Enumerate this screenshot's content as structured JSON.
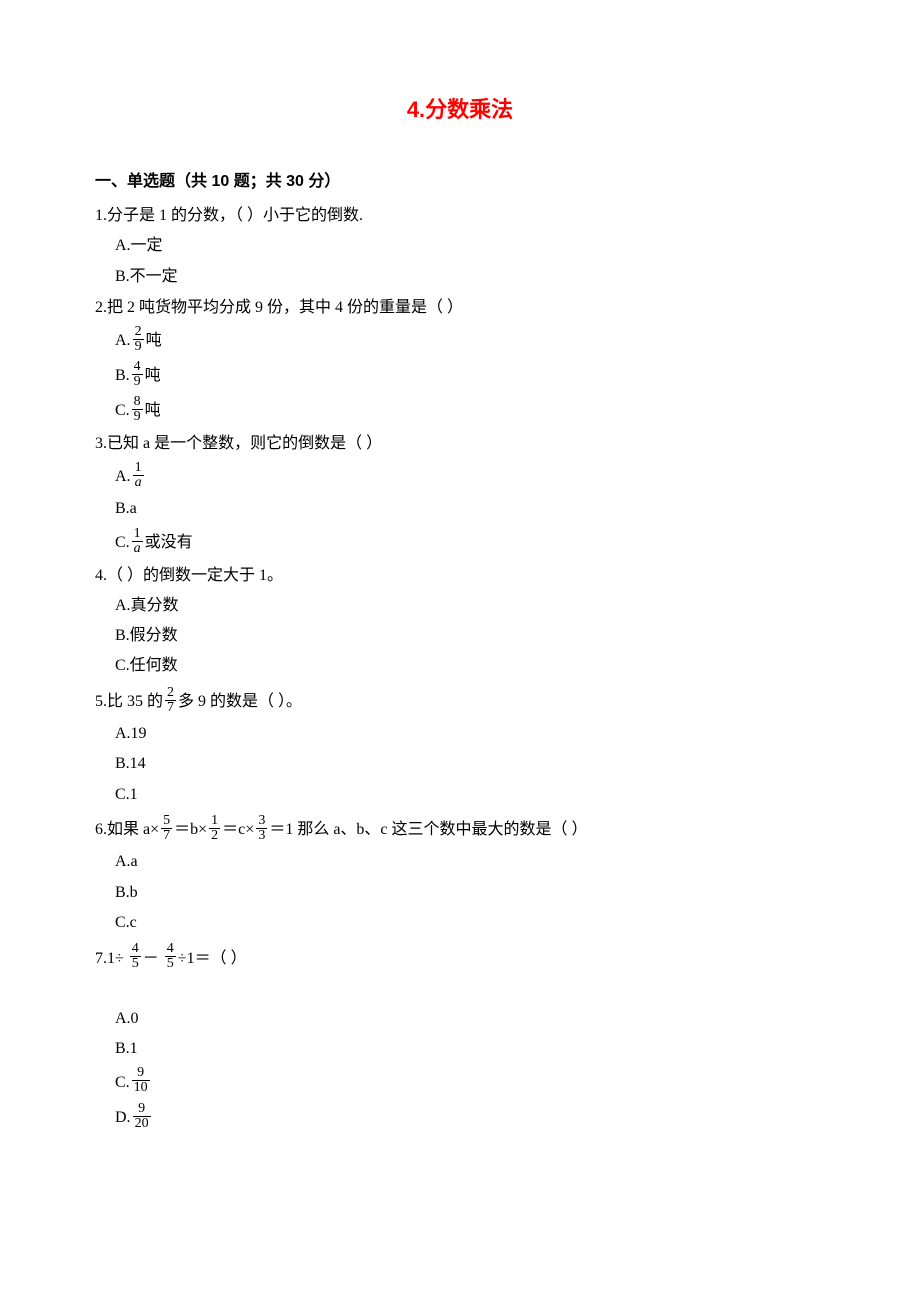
{
  "title": "4.分数乘法",
  "section_header": "一、单选题（共 10 题；共 30 分）",
  "q1": {
    "text": "1.分子是 1 的分数，（   ）小于它的倒数.",
    "A": "A.一定",
    "B": "B.不一定"
  },
  "q2": {
    "text_pre": "2.把 2 吨货物平均分成 9 份，其中 4 份的重量是（   ）",
    "A_pre": "A.",
    "A_num": "2",
    "A_den": "9",
    "A_post": "吨",
    "B_pre": "B.",
    "B_num": "4",
    "B_den": "9",
    "B_post": "吨",
    "C_pre": "C.",
    "C_num": "8",
    "C_den": "9",
    "C_post": "吨"
  },
  "q3": {
    "text": "3.已知 a 是一个整数，则它的倒数是（    ）",
    "A_pre": "A.",
    "A_num": "1",
    "A_den": "a",
    "B": "B.a",
    "C_pre": "C.",
    "C_num": "1",
    "C_den": "a",
    "C_post": "或没有"
  },
  "q4": {
    "text": "4.（            ）的倒数一定大于 1。",
    "A": "A.真分数",
    "B": "B.假分数",
    "C": "C.任何数"
  },
  "q5": {
    "text_pre": "5.比 35 的",
    "num": "2",
    "den": "7",
    "text_post": "多 9 的数是（            ）。",
    "A": "A.19",
    "B": "B.14",
    "C": "C.1"
  },
  "q6": {
    "text_pre": "6.如果 a×",
    "f1_num": "5",
    "f1_den": "7",
    "mid1": "＝b×",
    "f2_num": "1",
    "f2_den": "2",
    "mid2": "＝c×",
    "f3_num": "3",
    "f3_den": "3",
    "text_post": "＝1 那么 a、b、c 这三个数中最大的数是（    ）",
    "A": "A.a",
    "B": "B.b",
    "C": "C.c"
  },
  "q7": {
    "text_pre": "7.1÷ ",
    "f1_num": "4",
    "f1_den": "5",
    "mid": "－ ",
    "f2_num": "4",
    "f2_den": "5",
    "text_post": "÷1＝（   ）",
    "A": "A.0",
    "B": "B.1",
    "C_pre": "C.",
    "C_num": "9",
    "C_den": "10",
    "D_pre": "D.",
    "D_num": "9",
    "D_den": "20"
  }
}
